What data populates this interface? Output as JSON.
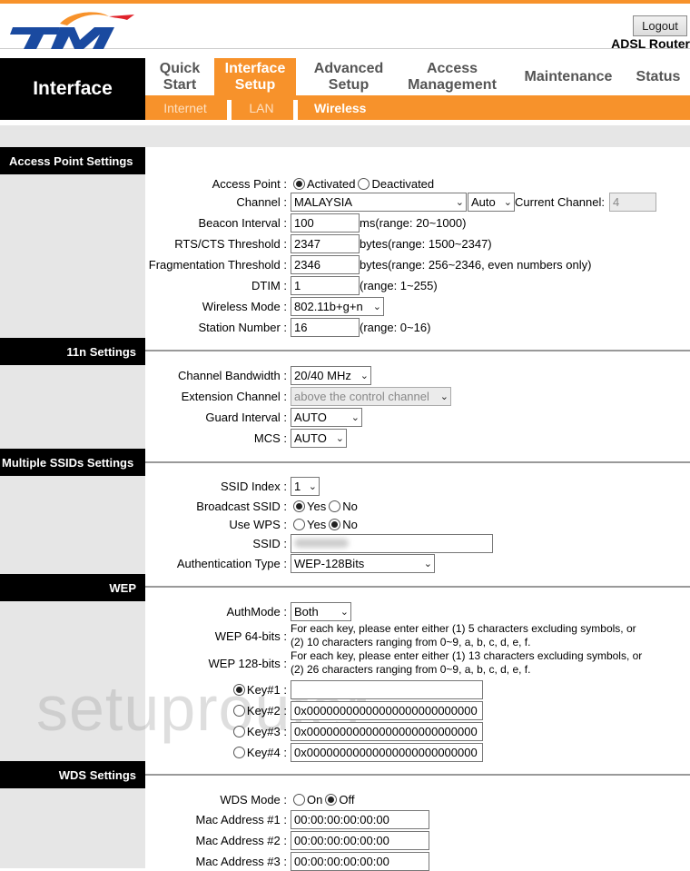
{
  "header": {
    "brand": "TM",
    "logout_label": "Logout",
    "model": "ADSL Router",
    "brand_colors": {
      "orange": "#f7922b",
      "blue": "#1a4aa0",
      "red": "#e0232b"
    }
  },
  "nav": {
    "section_title": "Interface",
    "tabs": [
      {
        "line1": "Quick",
        "line2": "Start"
      },
      {
        "line1": "Interface",
        "line2": "Setup",
        "active": true
      },
      {
        "line1": "Advanced",
        "line2": "Setup"
      },
      {
        "line1": "Access",
        "line2": "Management"
      },
      {
        "line1": "Maintenance",
        "line2": ""
      },
      {
        "line1": "Status",
        "line2": ""
      }
    ],
    "subtabs": [
      {
        "label": "Internet"
      },
      {
        "label": "LAN"
      },
      {
        "label": "Wireless",
        "active": true
      }
    ]
  },
  "access_point": {
    "title": "Access Point Settings",
    "access_point_label": "Access Point :",
    "activated_label": "Activated",
    "deactivated_label": "Deactivated",
    "access_point_value": "Activated",
    "channel_label": "Channel :",
    "channel_region": "MALAYSIA",
    "channel_value": "Auto",
    "current_channel_label": "Current Channel:",
    "current_channel": "4",
    "beacon_label": "Beacon Interval :",
    "beacon_value": "100",
    "beacon_hint": "ms(range: 20~1000)",
    "rts_label": "RTS/CTS Threshold :",
    "rts_value": "2347",
    "rts_hint": "bytes(range: 1500~2347)",
    "frag_label": "Fragmentation Threshold :",
    "frag_value": "2346",
    "frag_hint": "bytes(range: 256~2346, even numbers only)",
    "dtim_label": "DTIM :",
    "dtim_value": "1",
    "dtim_hint": "(range: 1~255)",
    "mode_label": "Wireless Mode :",
    "mode_value": "802.11b+g+n",
    "station_label": "Station Number :",
    "station_value": "16",
    "station_hint": "(range: 0~16)"
  },
  "n11": {
    "title": "11n Settings",
    "bandwidth_label": "Channel Bandwidth :",
    "bandwidth_value": "20/40 MHz",
    "ext_label": "Extension Channel :",
    "ext_value": "above the control channel",
    "guard_label": "Guard Interval :",
    "guard_value": "AUTO",
    "mcs_label": "MCS :",
    "mcs_value": "AUTO"
  },
  "ssid": {
    "title": "Multiple SSIDs Settings",
    "index_label": "SSID Index :",
    "index_value": "1",
    "broadcast_label": "Broadcast SSID :",
    "yes_label": "Yes",
    "no_label": "No",
    "broadcast_value": "Yes",
    "wps_label": "Use WPS :",
    "wps_value": "No",
    "ssid_label": "SSID :",
    "auth_label": "Authentication Type :",
    "auth_value": "WEP-128Bits"
  },
  "wep": {
    "title": "WEP",
    "authmode_label": "AuthMode :",
    "authmode_value": "Both",
    "wep64_label": "WEP 64-bits :",
    "wep64_note1": "For each key, please enter either (1) 5 characters excluding symbols, or",
    "wep64_note2": "(2) 10 characters ranging from 0~9, a, b, c, d, e, f.",
    "wep128_label": "WEP 128-bits :",
    "wep128_note1": "For each key, please enter either (1) 13 characters excluding symbols, or",
    "wep128_note2": "(2) 26 characters ranging from 0~9, a, b, c, d, e, f.",
    "keys": [
      {
        "label": "Key#1 :",
        "value": "",
        "selected": true
      },
      {
        "label": "Key#2 :",
        "value": "0x00000000000000000000000000",
        "selected": false
      },
      {
        "label": "Key#3 :",
        "value": "0x00000000000000000000000000",
        "selected": false
      },
      {
        "label": "Key#4 :",
        "value": "0x00000000000000000000000000",
        "selected": false
      }
    ]
  },
  "wds": {
    "title": "WDS Settings",
    "mode_label": "WDS Mode :",
    "on_label": "On",
    "off_label": "Off",
    "mode_value": "Off",
    "mac1_label": "Mac Address #1 :",
    "mac1_value": "00:00:00:00:00:00",
    "mac2_label": "Mac Address #2 :",
    "mac2_value": "00:00:00:00:00:00",
    "mac3_label": "Mac Address #3 :",
    "mac3_value": "00:00:00:00:00:00"
  },
  "watermark": "setuprouter"
}
